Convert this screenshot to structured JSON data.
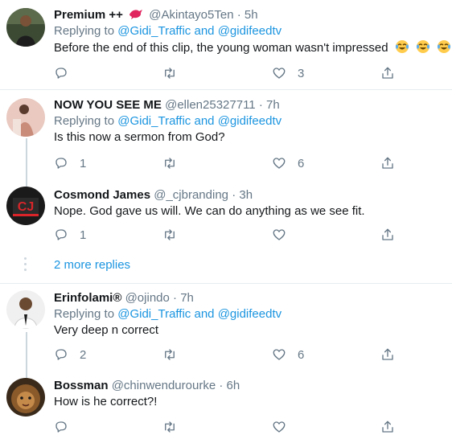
{
  "tweets": [
    {
      "name": "Premium",
      "name_suffix": "++",
      "handle": "@Akintayo5Ten",
      "time": "5h",
      "replying_prefix": "Replying to",
      "reply_user1": "@Gidi_Traffic",
      "reply_and": "and",
      "reply_user2": "@gidifeedtv",
      "text": "Before the end of this clip, the young woman wasn't impressed",
      "replies": "",
      "retweets": "",
      "likes": "3"
    },
    {
      "name": "NOW YOU SEE ME",
      "handle": "@ellen25327711",
      "time": "7h",
      "replying_prefix": "Replying to",
      "reply_user1": "@Gidi_Traffic",
      "reply_and": "and",
      "reply_user2": "@gidifeedtv",
      "text": "Is this now a sermon from God?",
      "replies": "1",
      "retweets": "",
      "likes": "6"
    },
    {
      "name": "Cosmond James",
      "handle": "@_cjbranding",
      "time": "3h",
      "text": "Nope. God gave us will. We can do anything as we see fit.",
      "replies": "1",
      "retweets": "",
      "likes": ""
    },
    {
      "name": "Erinfolami®",
      "handle": "@ojindo",
      "time": "7h",
      "replying_prefix": "Replying to",
      "reply_user1": "@Gidi_Traffic",
      "reply_and": "and",
      "reply_user2": "@gidifeedtv",
      "text": "Very deep n correct",
      "replies": "2",
      "retweets": "",
      "likes": "6"
    },
    {
      "name": "Bossman",
      "handle": "@chinwendurourke",
      "time": "6h",
      "text": "How is he correct?!",
      "replies": "",
      "retweets": "",
      "likes": ""
    }
  ],
  "more_replies": "2 more replies",
  "separator": "·",
  "icons": {
    "reply": "reply-icon",
    "retweet": "retweet-icon",
    "like": "heart-icon",
    "share": "share-icon",
    "emoji": "tears-of-joy-emoji"
  },
  "colors": {
    "link": "#1b95e0",
    "secondary": "#657786",
    "border": "#e6ecf0"
  }
}
